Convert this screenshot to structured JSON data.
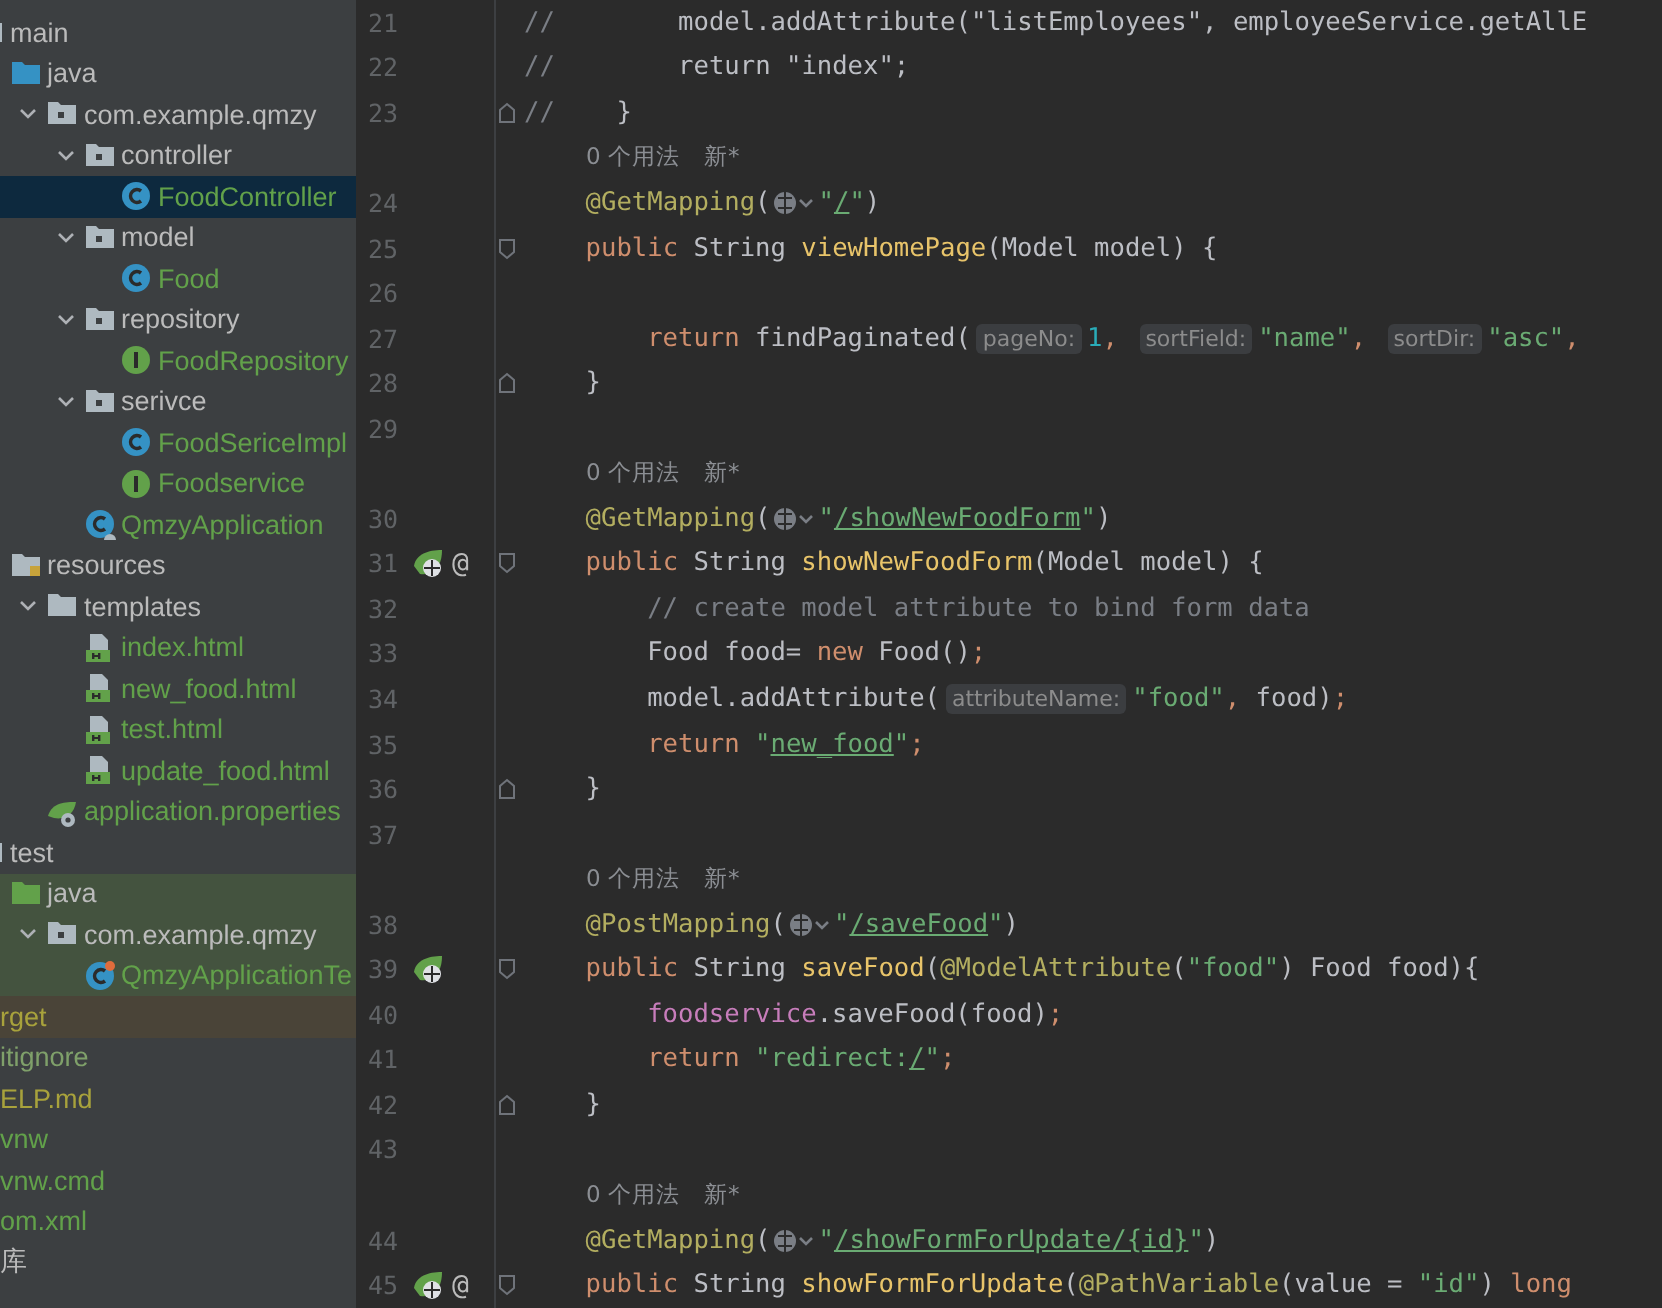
{
  "project_tree": [
    {
      "label": "main",
      "kind": "source-folder",
      "selected": false,
      "color": "#bbbbbb",
      "children": [
        {
          "label": "java",
          "kind": "java-folder",
          "selected": false,
          "color": "#bbbbbb",
          "children": [
            {
              "label": "com.example.qmzy",
              "kind": "package",
              "expanded": true,
              "selected": false,
              "color": "#bbbbbb",
              "children": [
                {
                  "label": "controller",
                  "kind": "package",
                  "expanded": true,
                  "selected": false,
                  "color": "#bbbbbb",
                  "children": [
                    {
                      "label": "FoodController",
                      "kind": "class",
                      "selected": true,
                      "color": "#62a14a"
                    }
                  ]
                },
                {
                  "label": "model",
                  "kind": "package",
                  "expanded": true,
                  "selected": false,
                  "color": "#bbbbbb",
                  "children": [
                    {
                      "label": "Food",
                      "kind": "class",
                      "selected": false,
                      "color": "#62a14a"
                    }
                  ]
                },
                {
                  "label": "repository",
                  "kind": "package",
                  "expanded": true,
                  "selected": false,
                  "color": "#bbbbbb",
                  "children": [
                    {
                      "label": "FoodRepository",
                      "kind": "interface",
                      "selected": false,
                      "color": "#62a14a"
                    }
                  ]
                },
                {
                  "label": "serivce",
                  "kind": "package",
                  "expanded": true,
                  "selected": false,
                  "color": "#bbbbbb",
                  "children": [
                    {
                      "label": "FoodSericeImpl",
                      "kind": "class",
                      "selected": false,
                      "color": "#62a14a"
                    },
                    {
                      "label": "Foodservice",
                      "kind": "interface",
                      "selected": false,
                      "color": "#62a14a"
                    }
                  ]
                },
                {
                  "label": "QmzyApplication",
                  "kind": "app",
                  "selected": false,
                  "color": "#62a14a"
                }
              ]
            }
          ]
        },
        {
          "label": "resources",
          "kind": "resources-folder",
          "selected": false,
          "color": "#bbbbbb",
          "children": [
            {
              "label": "templates",
              "kind": "folder",
              "expanded": true,
              "selected": false,
              "color": "#bbbbbb",
              "children": [
                {
                  "label": "index.html",
                  "kind": "html",
                  "selected": false,
                  "color": "#62a14a"
                },
                {
                  "label": "new_food.html",
                  "kind": "html",
                  "selected": false,
                  "color": "#62a14a"
                },
                {
                  "label": "test.html",
                  "kind": "html",
                  "selected": false,
                  "color": "#62a14a"
                },
                {
                  "label": "update_food.html",
                  "kind": "html",
                  "selected": false,
                  "color": "#62a14a"
                }
              ]
            },
            {
              "label": "application.properties",
              "kind": "properties",
              "selected": false,
              "color": "#62a14a"
            }
          ]
        }
      ]
    },
    {
      "label": "test",
      "kind": "source-folder",
      "selected": false,
      "color": "#bbbbbb",
      "children": [
        {
          "label": "java",
          "kind": "test-folder",
          "selected": false,
          "color": "#bbbbbb",
          "test_scope": true,
          "children": [
            {
              "label": "com.example.qmzy",
              "kind": "package",
              "expanded": true,
              "selected": false,
              "color": "#bbbbbb",
              "test_scope": true,
              "children": [
                {
                  "label": "QmzyApplicationTe",
                  "kind": "test-class",
                  "selected": false,
                  "color": "#62a14a",
                  "test_scope": true
                }
              ]
            }
          ]
        }
      ]
    },
    {
      "label": "rget",
      "kind": "plain",
      "selected": false,
      "color": "#a8a23c",
      "excluded": true
    },
    {
      "label": "itignore",
      "kind": "plain",
      "selected": false,
      "color": "#7fa06a"
    },
    {
      "label": "ELP.md",
      "kind": "plain",
      "selected": false,
      "color": "#a8a23c"
    },
    {
      "label": "vnw",
      "kind": "plain",
      "selected": false,
      "color": "#62a14a"
    },
    {
      "label": "vnw.cmd",
      "kind": "plain",
      "selected": false,
      "color": "#62a14a"
    },
    {
      "label": "om.xml",
      "kind": "plain",
      "selected": false,
      "color": "#62a14a"
    },
    {
      "label": "库",
      "kind": "plain",
      "selected": false,
      "color": "#bbbbbb"
    }
  ],
  "editor_lines": [
    {
      "kind": "code",
      "number": "21",
      "tokens": [
        {
          "kind": "comment",
          "text": "//"
        },
        {
          "kind": "plain",
          "text": "        model.addAttribute("
        },
        {
          "kind": "plain",
          "text": "\"listEmployees\""
        },
        {
          "kind": "plain",
          "text": ", employeeService.getAllE"
        }
      ]
    },
    {
      "kind": "code",
      "number": "22",
      "tokens": [
        {
          "kind": "comment",
          "text": "//"
        },
        {
          "kind": "plain",
          "text": "        return \"index\";"
        }
      ]
    },
    {
      "kind": "code",
      "number": "23",
      "fold_close": true,
      "tokens": [
        {
          "kind": "comment",
          "text": "//"
        },
        {
          "kind": "plain",
          "text": "    }"
        }
      ]
    },
    {
      "kind": "hint",
      "usages": "0 个用法",
      "tag": "新*"
    },
    {
      "kind": "code",
      "number": "24",
      "indented": true,
      "tokens": [
        {
          "kind": "annotation",
          "text": "@GetMapping"
        },
        {
          "kind": "plain",
          "text": "("
        },
        {
          "kind": "globe"
        },
        {
          "kind": "string",
          "text": "\""
        },
        {
          "kind": "link",
          "text": "/"
        },
        {
          "kind": "string",
          "text": "\""
        },
        {
          "kind": "plain",
          "text": ")"
        }
      ]
    },
    {
      "kind": "code",
      "number": "25",
      "indented": true,
      "fold_open": true,
      "tokens": [
        {
          "kind": "keyword",
          "text": "public"
        },
        {
          "kind": "plain",
          "text": " String "
        },
        {
          "kind": "method",
          "text": "viewHomePage"
        },
        {
          "kind": "plain",
          "text": "(Model model) {"
        }
      ]
    },
    {
      "kind": "code",
      "number": "26"
    },
    {
      "kind": "code",
      "number": "27",
      "indented": true,
      "nested": true,
      "tokens": [
        {
          "kind": "keyword",
          "text": "return"
        },
        {
          "kind": "plain",
          "text": " findPaginated("
        },
        {
          "kind": "inlay",
          "text": "pageNo:"
        },
        {
          "kind": "number",
          "text": "1"
        },
        {
          "kind": "keyword",
          "text": ", "
        },
        {
          "kind": "inlay",
          "text": "sortField:"
        },
        {
          "kind": "string",
          "text": "\"name\""
        },
        {
          "kind": "keyword",
          "text": ", "
        },
        {
          "kind": "inlay",
          "text": "sortDir:"
        },
        {
          "kind": "string",
          "text": "\"asc\""
        },
        {
          "kind": "keyword",
          "text": ","
        }
      ]
    },
    {
      "kind": "code",
      "number": "28",
      "indented": true,
      "fold_close": true,
      "tokens": [
        {
          "kind": "plain",
          "text": "}"
        }
      ]
    },
    {
      "kind": "code",
      "number": "29"
    },
    {
      "kind": "hint",
      "usages": "0 个用法",
      "tag": "新*"
    },
    {
      "kind": "code",
      "number": "30",
      "indented": true,
      "tokens": [
        {
          "kind": "annotation",
          "text": "@GetMapping"
        },
        {
          "kind": "plain",
          "text": "("
        },
        {
          "kind": "globe"
        },
        {
          "kind": "string",
          "text": "\""
        },
        {
          "kind": "link",
          "text": "/showNewFoodForm"
        },
        {
          "kind": "string",
          "text": "\""
        },
        {
          "kind": "plain",
          "text": ")"
        }
      ]
    },
    {
      "kind": "code",
      "number": "31",
      "indented": true,
      "fold_open": true,
      "gutter": [
        {
          "kind": "endpoint"
        },
        {
          "kind": "symbol",
          "text": "@"
        }
      ],
      "tokens": [
        {
          "kind": "keyword",
          "text": "public"
        },
        {
          "kind": "plain",
          "text": " String "
        },
        {
          "kind": "method",
          "text": "showNewFoodForm"
        },
        {
          "kind": "plain",
          "text": "(Model model) {"
        }
      ]
    },
    {
      "kind": "code",
      "number": "32",
      "indented": true,
      "nested": true,
      "tokens": [
        {
          "kind": "comment",
          "text": "// create model attribute to bind form data"
        }
      ]
    },
    {
      "kind": "code",
      "number": "33",
      "indented": true,
      "nested": true,
      "tokens": [
        {
          "kind": "plain",
          "text": "Food food= "
        },
        {
          "kind": "keyword",
          "text": "new"
        },
        {
          "kind": "plain",
          "text": " Food()"
        },
        {
          "kind": "keyword",
          "text": ";"
        }
      ]
    },
    {
      "kind": "code",
      "number": "34",
      "indented": true,
      "nested": true,
      "tokens": [
        {
          "kind": "plain",
          "text": "model.addAttribute("
        },
        {
          "kind": "inlay",
          "text": "attributeName:"
        },
        {
          "kind": "string",
          "text": "\"food\""
        },
        {
          "kind": "keyword",
          "text": ", "
        },
        {
          "kind": "plain",
          "text": "food)"
        },
        {
          "kind": "keyword",
          "text": ";"
        }
      ]
    },
    {
      "kind": "code",
      "number": "35",
      "indented": true,
      "nested": true,
      "tokens": [
        {
          "kind": "keyword",
          "text": "return"
        },
        {
          "kind": "string",
          "text": " \""
        },
        {
          "kind": "link",
          "text": "new_food"
        },
        {
          "kind": "string",
          "text": "\""
        },
        {
          "kind": "keyword",
          "text": ";"
        }
      ]
    },
    {
      "kind": "code",
      "number": "36",
      "indented": true,
      "fold_close": true,
      "tokens": [
        {
          "kind": "plain",
          "text": "}"
        }
      ]
    },
    {
      "kind": "code",
      "number": "37"
    },
    {
      "kind": "hint",
      "usages": "0 个用法",
      "tag": "新*"
    },
    {
      "kind": "code",
      "number": "38",
      "indented": true,
      "tokens": [
        {
          "kind": "annotation",
          "text": "@PostMapping"
        },
        {
          "kind": "plain",
          "text": "("
        },
        {
          "kind": "globe"
        },
        {
          "kind": "string",
          "text": "\""
        },
        {
          "kind": "link",
          "text": "/saveFood"
        },
        {
          "kind": "string",
          "text": "\""
        },
        {
          "kind": "plain",
          "text": ")"
        }
      ]
    },
    {
      "kind": "code",
      "number": "39",
      "indented": true,
      "fold_open": true,
      "gutter": [
        {
          "kind": "endpoint"
        }
      ],
      "tokens": [
        {
          "kind": "keyword",
          "text": "public"
        },
        {
          "kind": "plain",
          "text": " String "
        },
        {
          "kind": "method",
          "text": "saveFood"
        },
        {
          "kind": "plain",
          "text": "("
        },
        {
          "kind": "annotation",
          "text": "@ModelAttribute"
        },
        {
          "kind": "plain",
          "text": "("
        },
        {
          "kind": "string",
          "text": "\"food\""
        },
        {
          "kind": "plain",
          "text": ") Food food){"
        }
      ]
    },
    {
      "kind": "code",
      "number": "40",
      "indented": true,
      "nested": true,
      "tokens": [
        {
          "kind": "field",
          "text": "foodservice"
        },
        {
          "kind": "plain",
          "text": ".saveFood(food)"
        },
        {
          "kind": "keyword",
          "text": ";"
        }
      ]
    },
    {
      "kind": "code",
      "number": "41",
      "indented": true,
      "nested": true,
      "tokens": [
        {
          "kind": "keyword",
          "text": "return"
        },
        {
          "kind": "string",
          "text": " \"redirect:"
        },
        {
          "kind": "link",
          "text": "/"
        },
        {
          "kind": "string",
          "text": "\""
        },
        {
          "kind": "keyword",
          "text": ";"
        }
      ]
    },
    {
      "kind": "code",
      "number": "42",
      "indented": true,
      "fold_close": true,
      "tokens": [
        {
          "kind": "plain",
          "text": "}"
        }
      ]
    },
    {
      "kind": "code",
      "number": "43"
    },
    {
      "kind": "hint",
      "usages": "0 个用法",
      "tag": "新*"
    },
    {
      "kind": "code",
      "number": "44",
      "indented": true,
      "tokens": [
        {
          "kind": "annotation",
          "text": "@GetMapping"
        },
        {
          "kind": "plain",
          "text": "("
        },
        {
          "kind": "globe"
        },
        {
          "kind": "string",
          "text": "\""
        },
        {
          "kind": "link",
          "text": "/showFormForUpdate/{id}"
        },
        {
          "kind": "string",
          "text": "\""
        },
        {
          "kind": "plain",
          "text": ")"
        }
      ]
    },
    {
      "kind": "code",
      "number": "45",
      "indented": true,
      "fold_open": true,
      "gutter": [
        {
          "kind": "endpoint"
        },
        {
          "kind": "symbol",
          "text": "@"
        }
      ],
      "tokens": [
        {
          "kind": "keyword",
          "text": "public"
        },
        {
          "kind": "plain",
          "text": " String "
        },
        {
          "kind": "method",
          "text": "showFormForUpdate"
        },
        {
          "kind": "plain",
          "text": "("
        },
        {
          "kind": "annotation",
          "text": "@PathVariable"
        },
        {
          "kind": "plain",
          "text": "(value = "
        },
        {
          "kind": "string",
          "text": "\"id\""
        },
        {
          "kind": "plain",
          "text": ") "
        },
        {
          "kind": "keyword",
          "text": "long"
        }
      ]
    }
  ]
}
